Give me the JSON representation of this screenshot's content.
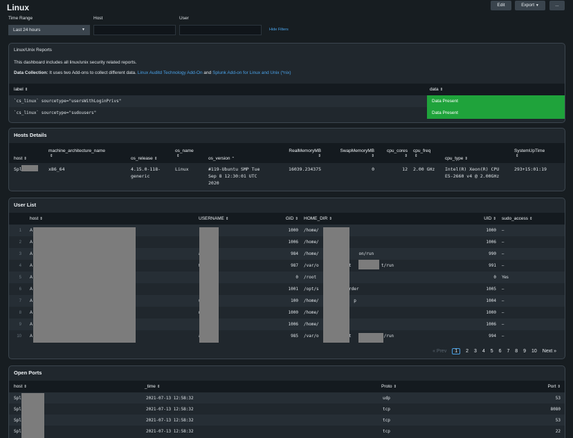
{
  "header": {
    "title": "Linux",
    "edit_label": "Edit",
    "export_label": "Export",
    "more_label": "..."
  },
  "filters": {
    "time_range_label": "Time Range",
    "time_range_value": "Last 24 hours",
    "host_label": "Host",
    "host_value": "",
    "user_label": "User",
    "user_value": "",
    "hide_filters_label": "Hide Filters"
  },
  "reports": {
    "title": "Linux/Unix Reports",
    "description": "This dashboard includes all linux/unix security related reports.",
    "data_collection_label": "Data Collection:",
    "data_collection_text": "It uses two Add-ons to collect different data.",
    "addon1": "Linux Auditd Technology Add-On",
    "and": "and",
    "addon2": "Splunk Add-on for Linux and Unix (*nix)",
    "columns": [
      "label",
      "data"
    ],
    "rows": [
      {
        "label": "`cs_linux` sourcetype=\"usersWithLoginPrivs\"",
        "data": "Data Present"
      },
      {
        "label": "`cs_linux` sourcetype=\"sudousers\"",
        "data": "Data Present"
      }
    ]
  },
  "hosts": {
    "title": "Hosts Details",
    "columns": [
      "host",
      "machine_architecture_name",
      "os_release",
      "os_name",
      "os_version",
      "RealMemoryMB",
      "SwapMemoryMB",
      "cpu_cores",
      "cpu_freq",
      "cpu_type",
      "SystemUpTime"
    ],
    "row": {
      "host": "Spl",
      "machine_architecture_name": "x86_64",
      "os_release": "4.15.0-118-\ngeneric",
      "os_name": "Linux",
      "os_version": "#119-Ubuntu SMP Tue\nSep 8 12:30:01 UTC\n2020",
      "RealMemoryMB": "16039.234375",
      "SwapMemoryMB": "0",
      "cpu_cores": "12",
      "cpu_freq": "2.00 GHz",
      "cpu_type": "Intel(R) Xeon(R) CPU\nE5-2660 v4 @ 2.00GHz",
      "SystemUpTime": "293+15:01:19"
    }
  },
  "users": {
    "title": "User List",
    "columns": [
      "host",
      "USERNAME",
      "GID",
      "HOME_DIR",
      "UID",
      "sudo_access"
    ],
    "rows": [
      {
        "n": "1",
        "host": "A",
        "username": "",
        "gid": "1000",
        "home": "/home/",
        "uid": "1000",
        "sudo": "–"
      },
      {
        "n": "2",
        "host": "A",
        "username": "",
        "gid": "1006",
        "home": "/home/",
        "uid": "1006",
        "sudo": "–"
      },
      {
        "n": "3",
        "host": "A",
        "username": "ation",
        "gid": "984",
        "home": "/home/                on/run",
        "uid": "990",
        "sudo": "–"
      },
      {
        "n": "4",
        "host": "A",
        "username": "t",
        "gid": "987",
        "home": "/var/o           ft            t/run",
        "uid": "991",
        "sudo": "–"
      },
      {
        "n": "5",
        "host": "A",
        "username": "",
        "gid": "0",
        "home": "/root",
        "uid": "0",
        "sudo": "Yes"
      },
      {
        "n": "6",
        "host": "A",
        "username": "",
        "gid": "1001",
        "home": "/opt/s            rder",
        "uid": "1005",
        "sudo": "–"
      },
      {
        "n": "7",
        "host": "A",
        "username": "weep",
        "gid": "100",
        "home": "/home/              p",
        "uid": "1004",
        "sudo": "–"
      },
      {
        "n": "8",
        "host": "A",
        "username": "n",
        "gid": "1000",
        "home": "/home/",
        "uid": "1000",
        "sudo": "–"
      },
      {
        "n": "9",
        "host": "A",
        "username": "",
        "gid": "1006",
        "home": "/home/",
        "uid": "1006",
        "sudo": "–"
      },
      {
        "n": "10",
        "host": "A",
        "username": "ation",
        "gid": "985",
        "home": "/var/o           ft             /run",
        "uid": "994",
        "sudo": "–"
      }
    ],
    "pager": {
      "prev": "« Prev",
      "pages": [
        "1",
        "2",
        "3",
        "4",
        "5",
        "6",
        "7",
        "8",
        "9",
        "10"
      ],
      "next": "Next »"
    }
  },
  "ports": {
    "title": "Open Ports",
    "columns": [
      "host",
      "_time",
      "Proto",
      "Port"
    ],
    "rows": [
      {
        "host": "Spl",
        "time": "2021-07-13 12:58:32",
        "proto": "udp",
        "port": "53"
      },
      {
        "host": "Spl",
        "time": "2021-07-13 12:58:32",
        "proto": "tcp",
        "port": "8080"
      },
      {
        "host": "Spl",
        "time": "2021-07-13 12:58:32",
        "proto": "tcp",
        "port": "53"
      },
      {
        "host": "Spl",
        "time": "2021-07-13 12:58:32",
        "proto": "tcp",
        "port": "22"
      }
    ]
  },
  "colors": {
    "background": "#171d21",
    "panel": "#20272d",
    "link": "#4aa2e8",
    "data_present": "#1fa33b"
  }
}
